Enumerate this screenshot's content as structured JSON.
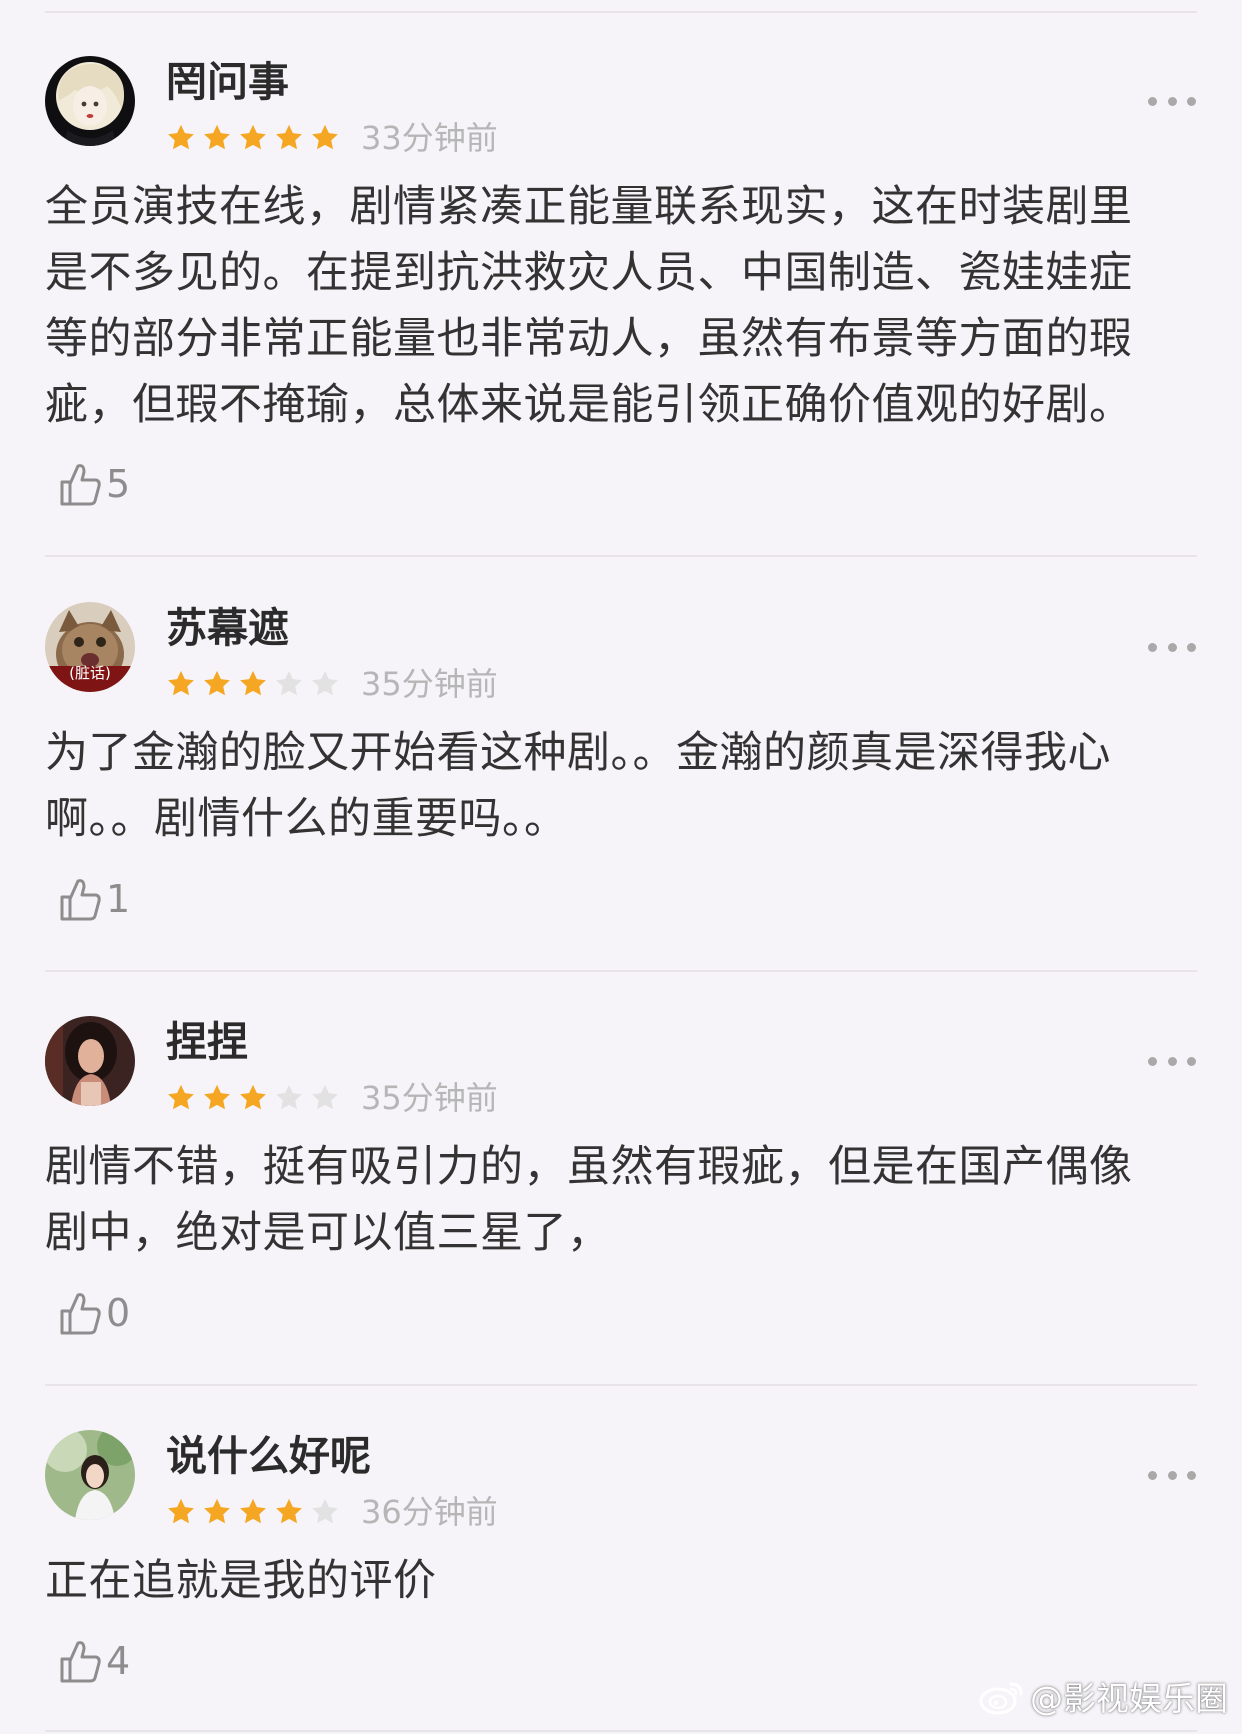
{
  "reviews": [
    {
      "username": "罔问事",
      "rating": 5,
      "max_rating": 5,
      "time": "33分钟前",
      "comment": "全员演技在线，剧情紧凑正能量联系现实，这在时装剧里\n是不多见的。在提到抗洪救灾人员、中国制造、瓷娃娃症\n等的部分非常正能量也非常动人，虽然有布景等方面的瑕\n疵，但瑕不掩瑜，总体来说是能引领正确价值观的好剧。",
      "likes": "5"
    },
    {
      "username": "苏幕遮",
      "rating": 3,
      "max_rating": 5,
      "time": "35分钟前",
      "comment": "为了金瀚的脸又开始看这种剧。。金瀚的颜真是深得我心\n啊。。剧情什么的重要吗。。",
      "likes": "1",
      "avatar_caption": "(脏话)"
    },
    {
      "username": "捏捏",
      "rating": 3,
      "max_rating": 5,
      "time": "35分钟前",
      "comment": "剧情不错，挺有吸引力的，虽然有瑕疵，但是在国产偶像\n剧中，绝对是可以值三星了，",
      "likes": "0"
    },
    {
      "username": "说什么好呢",
      "rating": 4,
      "max_rating": 5,
      "time": "36分钟前",
      "comment": "正在追就是我的评价",
      "likes": "4"
    }
  ],
  "icons": {
    "star_filled": "star-icon",
    "star_empty": "star-empty-icon",
    "more": "more-icon",
    "like": "thumbs-up-icon",
    "watermark": "weibo-logo-icon"
  },
  "colors": {
    "background": "#f6f4f8",
    "star_filled": "#f5a623",
    "star_empty": "#e2e2e2",
    "time_text": "#b6b6b6",
    "divider": "#e7e3e8"
  },
  "watermark": {
    "text": "@影视娱乐圈"
  }
}
